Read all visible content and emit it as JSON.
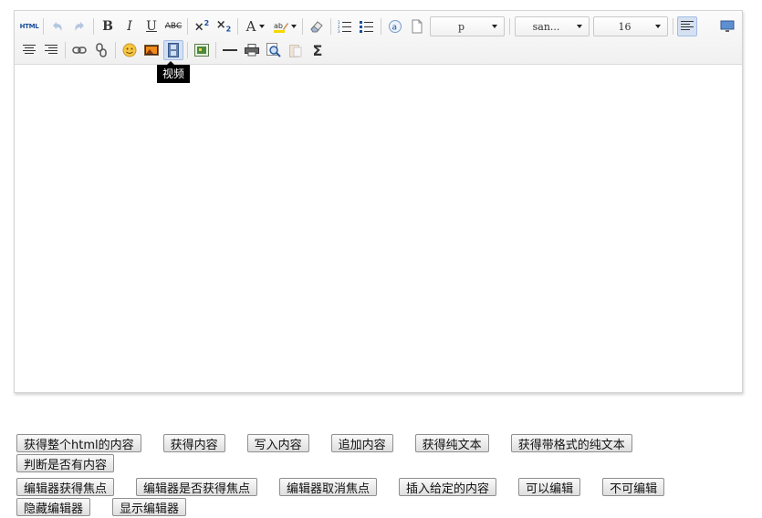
{
  "toolbar": {
    "html_label": "HTML",
    "block_format": "p",
    "font_family": "san...",
    "font_size": "16",
    "tooltip": "视频"
  },
  "buttons": [
    [
      "获得整个html的内容",
      "获得内容",
      "写入内容",
      "追加内容",
      "获得纯文本",
      "获得带格式的纯文本"
    ],
    [
      "判断是否有内容"
    ],
    [
      "编辑器获得焦点",
      "编辑器是否获得焦点",
      "编辑器取消焦点",
      "插入给定的内容",
      "可以编辑",
      "不可编辑"
    ],
    [
      "隐藏编辑器",
      "显示编辑器"
    ]
  ],
  "colors": {
    "accent": "#a3bde3",
    "active_bg": "#d5e1f2",
    "tooltip_bg": "#000000"
  }
}
